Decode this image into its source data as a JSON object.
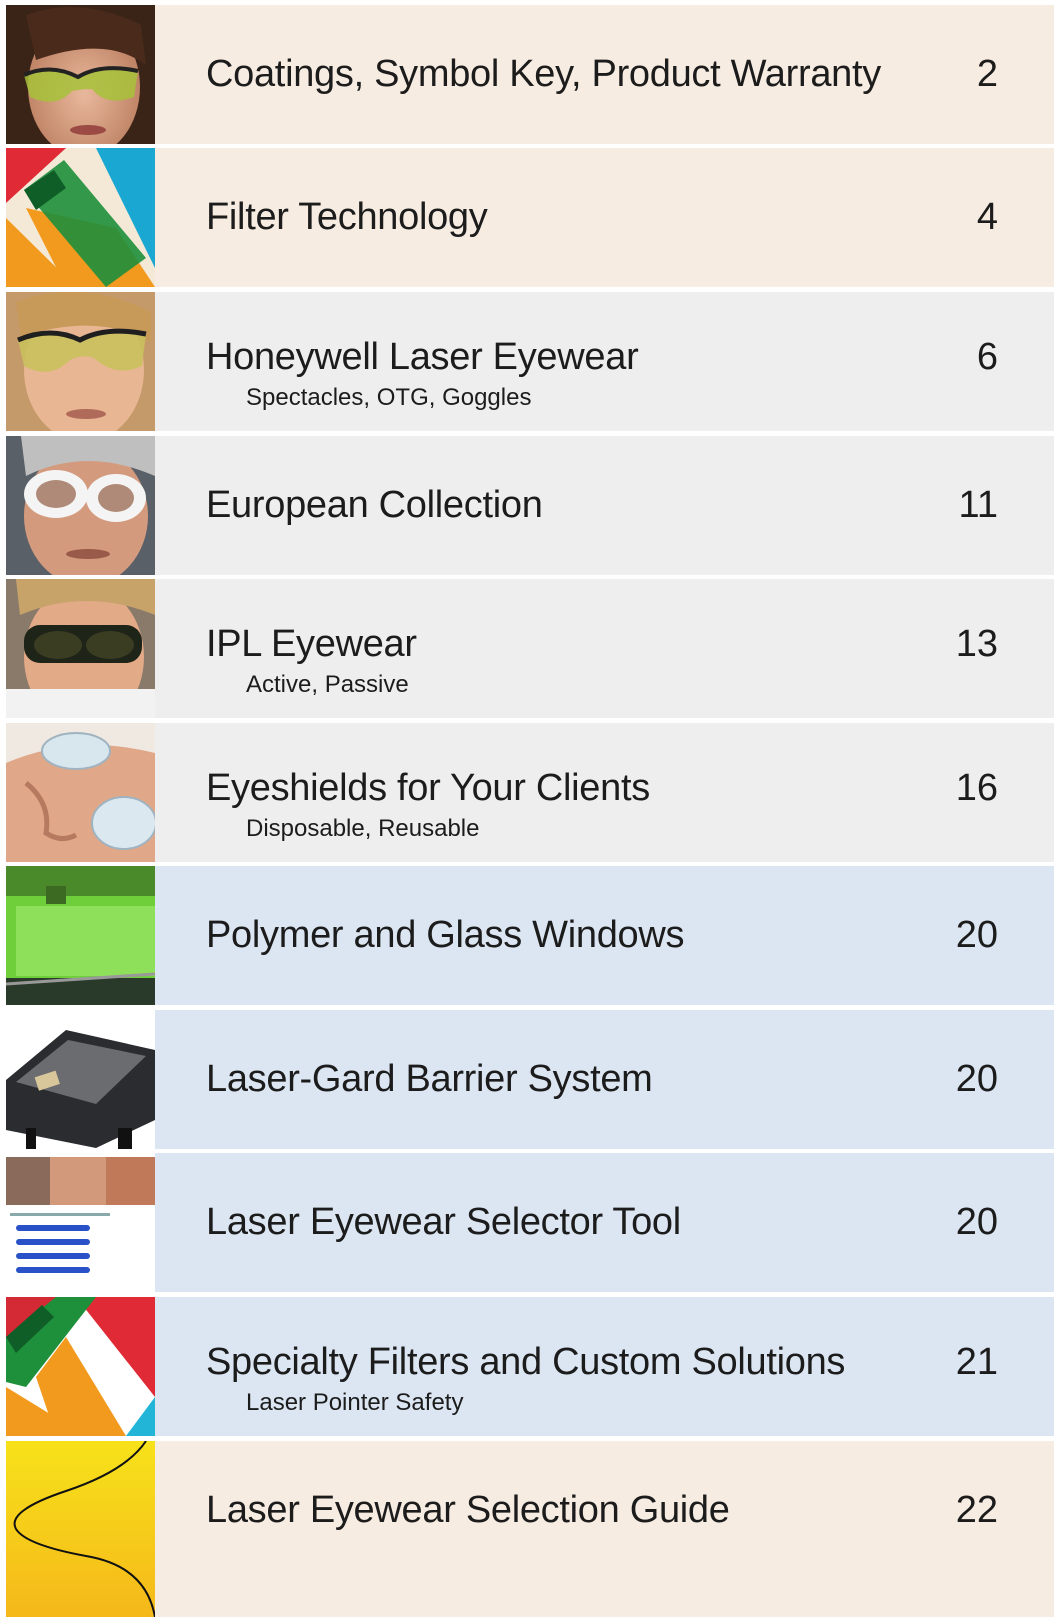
{
  "entries": [
    {
      "title": "Coatings, Symbol Key, Product Warranty",
      "subtitle": "",
      "page": "2",
      "image": "woman-tinted-safety-glasses-photo"
    },
    {
      "title": "Filter Technology",
      "subtitle": "",
      "page": "4",
      "image": "color-filter-graphic"
    },
    {
      "title": "Honeywell Laser Eyewear",
      "subtitle": "Spectacles, OTG, Goggles",
      "page": "6",
      "image": "woman-laser-glasses-photo"
    },
    {
      "title": "European Collection",
      "subtitle": "",
      "page": "11",
      "image": "man-white-goggles-photo"
    },
    {
      "title": "IPL Eyewear",
      "subtitle": "Active, Passive",
      "page": "13",
      "image": "man-dark-ipl-goggles-photo"
    },
    {
      "title": "Eyeshields for Your Clients",
      "subtitle": "Disposable, Reusable",
      "page": "16",
      "image": "client-eyeshields-photo"
    },
    {
      "title": "Polymer and Glass Windows",
      "subtitle": "",
      "page": "20",
      "image": "green-laser-window-photo"
    },
    {
      "title": "Laser-Gard Barrier System",
      "subtitle": "",
      "page": "20",
      "image": "barrier-enclosure-render"
    },
    {
      "title": "Laser Eyewear Selector Tool",
      "subtitle": "",
      "page": "20",
      "image": "selector-tool-webpage-screenshot"
    },
    {
      "title": "Specialty Filters and Custom Solutions",
      "subtitle": "Laser Pointer Safety",
      "page": "21",
      "image": "specialty-filter-graphic"
    },
    {
      "title": "Laser Eyewear Selection Guide",
      "subtitle": "",
      "page": "22",
      "image": "wave-curve-graphic"
    }
  ],
  "colors": {
    "peach_band": "#f6ece1",
    "gray_band": "#efeeee",
    "blue_band": "#dce6f3",
    "text": "#1c1c1c"
  }
}
